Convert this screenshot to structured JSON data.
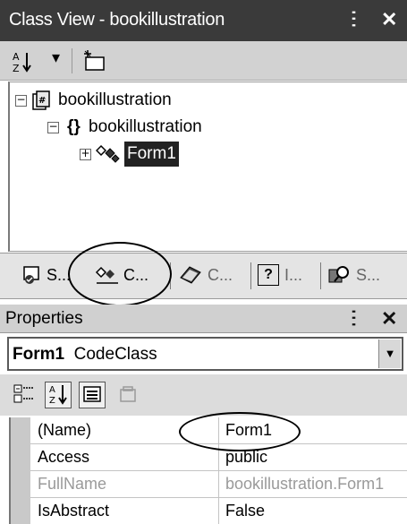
{
  "class_view": {
    "title": "Class View - bookillustration",
    "pin_label": "ⵗ",
    "close_label": "✕",
    "sort_label": "A↓Z",
    "dropdown_arrow": "▾",
    "tree": {
      "project": "bookillustration",
      "namespace_braces": "{}",
      "namespace": "bookillustration",
      "class_name": "Form1"
    },
    "tabs": [
      {
        "label": "S..."
      },
      {
        "label": "C..."
      },
      {
        "label": "C..."
      },
      {
        "label": "I..."
      },
      {
        "label": "S..."
      }
    ]
  },
  "properties": {
    "title": "Properties",
    "pin_label": "ⵗ",
    "close_label": "✕",
    "selector_object": "Form1",
    "selector_type": "CodeClass",
    "rows": [
      {
        "name": "(Name)",
        "value": "Form1"
      },
      {
        "name": "Access",
        "value": "public"
      },
      {
        "name": "FullName",
        "value": "bookillustration.Form1"
      },
      {
        "name": "IsAbstract",
        "value": "False"
      }
    ]
  },
  "colors": {
    "title_bar": "#3a3a3a",
    "selection": "#222222",
    "annotation_circle": "#000000"
  }
}
